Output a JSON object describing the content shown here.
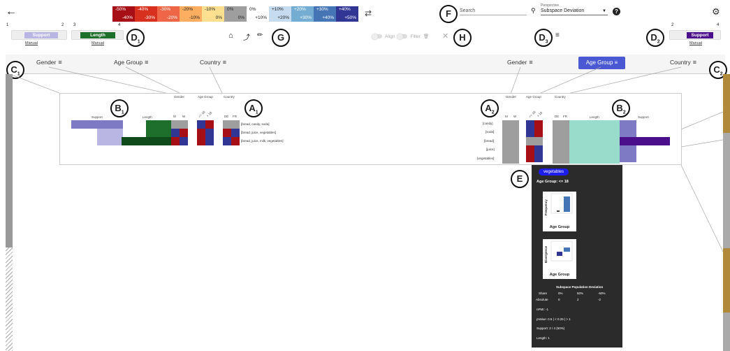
{
  "legend": [
    {
      "top": "-50%",
      "bottom": "-40%",
      "bg": "#a50f15",
      "fg": "#fff"
    },
    {
      "top": "-40%",
      "bottom": "-30%",
      "bg": "#d7301f",
      "fg": "#fff"
    },
    {
      "top": "-30%",
      "bottom": "-20%",
      "bg": "#ef6548",
      "fg": "#fff"
    },
    {
      "top": "-20%",
      "bottom": "-10%",
      "bg": "#fdae61",
      "fg": "#222"
    },
    {
      "top": "-10%",
      "bottom": "0%",
      "bg": "#fee090",
      "fg": "#222"
    },
    {
      "top": "0%",
      "bottom": "0%",
      "bg": "#9e9e9e",
      "fg": "#222"
    },
    {
      "top": "0%",
      "bottom": "+10%",
      "bg": "#ffffff",
      "fg": "#222"
    },
    {
      "top": "+10%",
      "bottom": "+20%",
      "bg": "#c6dbef",
      "fg": "#222"
    },
    {
      "top": "+20%",
      "bottom": "+30%",
      "bg": "#74add1",
      "fg": "#fff"
    },
    {
      "top": "+30%",
      "bottom": "+40%",
      "bg": "#4575b4",
      "fg": "#fff"
    },
    {
      "top": "+40%",
      "bottom": "+50%",
      "bg": "#313695",
      "fg": "#fff"
    }
  ],
  "search": {
    "placeholder": "Search"
  },
  "perspective": {
    "label": "Perspective",
    "value": "Subspace Deviation"
  },
  "sliders": {
    "support_left": {
      "label": "Support",
      "min": "1",
      "max": "2",
      "manual": "Manual"
    },
    "length_left": {
      "label": "Length",
      "min": "3",
      "max": "4",
      "manual": "Manual"
    },
    "support_right": {
      "label": "Support",
      "min": "2",
      "max": "4",
      "manual": "Manual"
    }
  },
  "toolbar": {
    "align": "Align",
    "filter": "Filter"
  },
  "header": {
    "left": [
      "Gender",
      "Age Group",
      "Country"
    ],
    "right": [
      "Gender",
      "Age Group",
      "Country"
    ]
  },
  "badges": {
    "D1": "D",
    "D1s": "1",
    "G": "G",
    "F": "F",
    "H": "H",
    "D3": "D",
    "D3s": "3",
    "D2": "D",
    "D2s": "2",
    "C1": "C",
    "C1s": "1",
    "C2": "C",
    "C2s": "2",
    "B1": "B",
    "B1s": "1",
    "A1": "A",
    "A1s": "1",
    "A2": "A",
    "A2s": "2",
    "B2": "B",
    "B2s": "2",
    "E": "E"
  },
  "panel": {
    "left_cols": {
      "gender": "Gender",
      "age": "Age Group",
      "country": "Country",
      "support": "Support",
      "length": "Length",
      "m": "M",
      "w": "W",
      "a1": "<= 18",
      "a2": "> 18",
      "de": "DE",
      "fr": "FR"
    },
    "itemsets": [
      "[bread, candy, soda]",
      "[bread, juice, vegetables]",
      "[bread, juice, milk, vegetables]"
    ],
    "items": [
      "[candy]",
      "[soda]",
      "[bread]",
      "[juice]",
      "[vegetables]"
    ],
    "right_cols": {
      "gender": "Gender",
      "age": "Age Group",
      "country": "Country",
      "length": "Length",
      "support": "Support",
      "m": "M",
      "w": "W",
      "a1": "<= 18",
      "a2": "> 18",
      "de": "DE",
      "fr": "FR"
    }
  },
  "tooltip": {
    "chip": "vegetables",
    "title": "Age Group: <= 18",
    "freq_label": "Frequency",
    "div_label": "Divergence",
    "chart_caption": "Age Group",
    "table_header": "Subspace Population Deviation",
    "share": [
      "Share",
      "0%",
      "50%",
      "-50%"
    ],
    "absolute": [
      "Absolute",
      "0",
      "2",
      "-2"
    ],
    "npmi": "nPMI: -1",
    "pvalue": "pValue: 0.5 | < 0.25 | > 1",
    "support": "Support: 2 / 4 (50%)",
    "length": "Length: 1"
  }
}
